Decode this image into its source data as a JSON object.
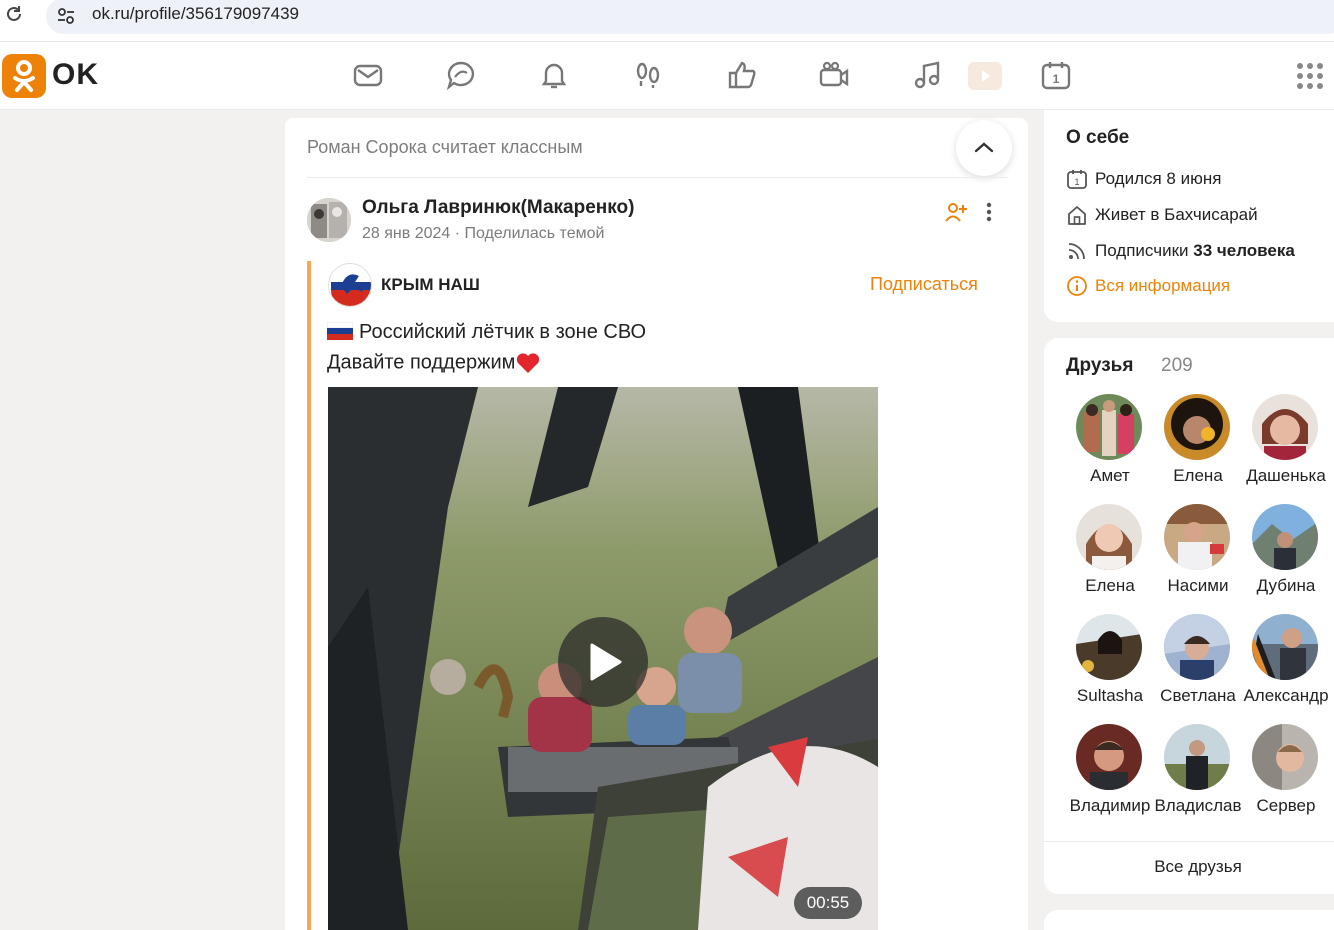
{
  "browser": {
    "url": "ok.ru/profile/356179097439",
    "icons": [
      "reload-icon",
      "site-settings-icon"
    ]
  },
  "header": {
    "logo_text": "OK",
    "nav_icons": [
      "messages-icon",
      "discussions-icon",
      "notifications-icon",
      "guests-icon",
      "marks-icon",
      "video-icon",
      "music-icon",
      "video-tile-icon",
      "calendar-icon"
    ],
    "apps_icon": "apps-grid-icon",
    "brand_color": "#ee8208"
  },
  "feed": {
    "liked_line": "Роман Сорока считает классным",
    "post": {
      "author": "Ольга Лавринюк(Макаренко)",
      "date": "28 янв 2024",
      "meta_separator": "·",
      "action": "Поделилась темой",
      "repost": {
        "group_name": "КРЫМ НАШ",
        "subscribe_label": "Подписаться",
        "text_line1": "Российский лётчик в зоне СВО",
        "text_line2": "Давайте поддержим",
        "video_duration": "00:55"
      }
    }
  },
  "about": {
    "title": "О себе",
    "born": "Родился 8 июня",
    "lives": "Живет в Бахчисарай",
    "subscribers_label": "Подписчики",
    "subscribers_value": "33 человека",
    "all_info": "Вся информация"
  },
  "friends": {
    "title": "Друзья",
    "count": "209",
    "items": [
      {
        "name": "Амет"
      },
      {
        "name": "Елена"
      },
      {
        "name": "Дашенька"
      },
      {
        "name": "Елена"
      },
      {
        "name": "Насими"
      },
      {
        "name": "Дубина"
      },
      {
        "name": "Sultasha"
      },
      {
        "name": "Светлана"
      },
      {
        "name": "Александр"
      },
      {
        "name": "Владимир"
      },
      {
        "name": "Владислав"
      },
      {
        "name": "Сервер"
      }
    ],
    "all_label": "Все друзья"
  }
}
